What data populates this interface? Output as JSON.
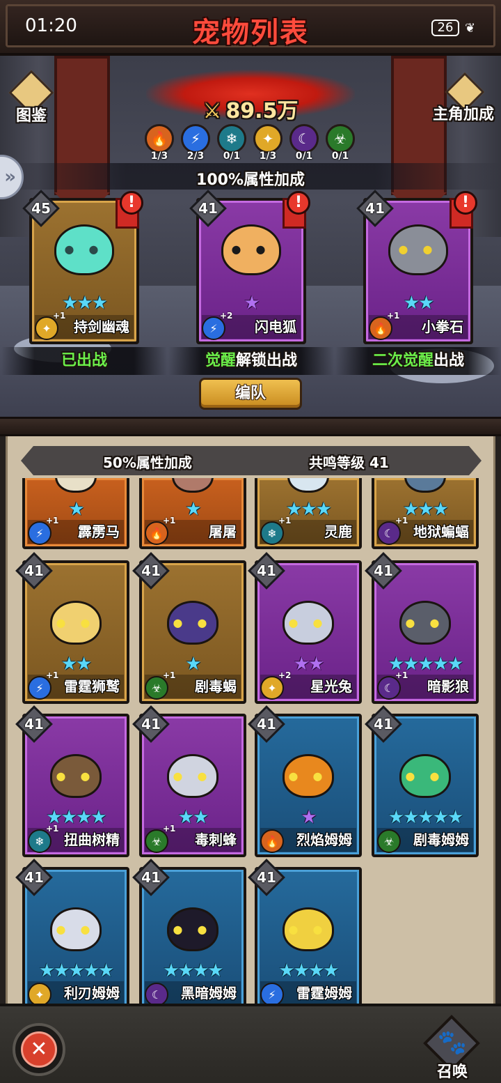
{
  "status_bar": {
    "time": "01:20",
    "alert_glyph": "!",
    "battery": "26"
  },
  "header": {
    "title": "宠物列表"
  },
  "scene": {
    "atlas_label": "图鉴",
    "hero_bonus_label": "主角加成",
    "power": "89.5万",
    "elements": [
      {
        "icon": "fire-element-icon",
        "count": "1/3",
        "color": "#d8641e",
        "glyph": "🔥"
      },
      {
        "icon": "lightning-element-icon",
        "count": "2/3",
        "color": "#2a6ee0",
        "glyph": "⚡"
      },
      {
        "icon": "ice-element-icon",
        "count": "0/1",
        "color": "#1e7a8a",
        "glyph": "❄"
      },
      {
        "icon": "light-element-icon",
        "count": "1/3",
        "color": "#e0a828",
        "glyph": "✦"
      },
      {
        "icon": "dark-element-icon",
        "count": "0/1",
        "color": "#5a2a8a",
        "glyph": "☾"
      },
      {
        "icon": "poison-element-icon",
        "count": "0/1",
        "color": "#2a7a2a",
        "glyph": "☣"
      }
    ],
    "attribute_bonus": "100%属性加成",
    "team_button": "编队"
  },
  "deployed": [
    {
      "name": "持剑幽魂",
      "level": "45",
      "stars": "★★★",
      "star_type": "b",
      "rarity": "gold",
      "element": "light",
      "plus": "+1",
      "status_parts": [
        {
          "text": "已出战",
          "color": "g"
        }
      ],
      "pet_color": "#5ee0c8",
      "eye": "#2a4a4a"
    },
    {
      "name": "闪电狐",
      "level": "41",
      "stars": "★",
      "star_type": "p",
      "rarity": "purple",
      "element": "lightning",
      "plus": "+2",
      "status_parts": [
        {
          "text": "觉醒",
          "color": "g"
        },
        {
          "text": "解锁出战",
          "color": "w"
        }
      ],
      "pet_color": "#f0b060",
      "eye": "#1a1a1a"
    },
    {
      "name": "小拳石",
      "level": "41",
      "stars": "★★",
      "star_type": "b",
      "rarity": "purple",
      "element": "fire",
      "plus": "+1",
      "status_parts": [
        {
          "text": "二次觉醒",
          "color": "g"
        },
        {
          "text": "出战",
          "color": "w"
        }
      ],
      "pet_color": "#8a8e98",
      "eye": "#f0d030"
    }
  ],
  "list": {
    "attribute_bonus": "50%属性加成",
    "resonance": "共鸣等级 41",
    "pets": [
      {
        "name": "霹雳马",
        "level": "",
        "stars": "★",
        "star_type": "b",
        "rarity": "orange",
        "element": "lightning",
        "plus": "+1",
        "pet_color": "#e8e0c8",
        "partial": true
      },
      {
        "name": "屠屠",
        "level": "",
        "stars": "★",
        "star_type": "b",
        "rarity": "orange",
        "element": "fire",
        "plus": "+1",
        "pet_color": "#b07a6a",
        "partial": true
      },
      {
        "name": "灵鹿",
        "level": "",
        "stars": "★★★",
        "star_type": "b",
        "rarity": "gold",
        "element": "ice",
        "plus": "+1",
        "pet_color": "#d8e6f0",
        "partial": true
      },
      {
        "name": "地狱蝙蝠",
        "level": "",
        "stars": "★★★",
        "star_type": "b",
        "rarity": "gold",
        "element": "dark",
        "plus": "+1",
        "pet_color": "#5a7a9a",
        "partial": true
      },
      {
        "name": "雷霆狮鹫",
        "level": "41",
        "stars": "★★",
        "star_type": "b",
        "rarity": "gold",
        "element": "lightning",
        "plus": "+1",
        "pet_color": "#f0d070"
      },
      {
        "name": "剧毒蝎",
        "level": "41",
        "stars": "★",
        "star_type": "b",
        "rarity": "gold",
        "element": "poison",
        "plus": "+1",
        "pet_color": "#4a3a8a"
      },
      {
        "name": "星光兔",
        "level": "41",
        "stars": "★★",
        "star_type": "p",
        "rarity": "purple",
        "element": "light",
        "plus": "+2",
        "pet_color": "#c8cede"
      },
      {
        "name": "暗影狼",
        "level": "41",
        "stars": "★★★★★",
        "star_type": "b",
        "rarity": "purple",
        "element": "dark",
        "plus": "+1",
        "pet_color": "#5a5e6a"
      },
      {
        "name": "扭曲树精",
        "level": "41",
        "stars": "★★★★",
        "star_type": "b",
        "rarity": "purple",
        "element": "ice",
        "plus": "+1",
        "pet_color": "#7a5a3a"
      },
      {
        "name": "毒刺蜂",
        "level": "41",
        "stars": "★★",
        "star_type": "b",
        "rarity": "purple",
        "element": "poison",
        "plus": "+1",
        "pet_color": "#d0d4e0"
      },
      {
        "name": "烈焰姆姆",
        "level": "41",
        "stars": "★",
        "star_type": "p",
        "rarity": "blue",
        "element": "fire",
        "plus": "",
        "pet_color": "#e8881e"
      },
      {
        "name": "剧毒姆姆",
        "level": "41",
        "stars": "★★★★★",
        "star_type": "b",
        "rarity": "blue",
        "element": "poison",
        "plus": "",
        "pet_color": "#3ab87a"
      },
      {
        "name": "利刃姆姆",
        "level": "41",
        "stars": "★★★★★",
        "star_type": "b",
        "rarity": "blue",
        "element": "light",
        "plus": "",
        "pet_color": "#d8dce8"
      },
      {
        "name": "黑暗姆姆",
        "level": "41",
        "stars": "★★★★",
        "star_type": "b",
        "rarity": "blue",
        "element": "dark",
        "plus": "",
        "pet_color": "#1e1a2a"
      },
      {
        "name": "雷霆姆姆",
        "level": "41",
        "stars": "★★★★",
        "star_type": "b",
        "rarity": "blue",
        "element": "lightning",
        "plus": "",
        "pet_color": "#f0d040"
      }
    ]
  },
  "bottom": {
    "summon_label": "召唤"
  },
  "element_styles": {
    "fire": {
      "color": "#d8641e",
      "glyph": "🔥"
    },
    "lightning": {
      "color": "#2a6ee0",
      "glyph": "⚡"
    },
    "ice": {
      "color": "#1e7a8a",
      "glyph": "❄"
    },
    "light": {
      "color": "#e0a828",
      "glyph": "✦"
    },
    "dark": {
      "color": "#5a2a8a",
      "glyph": "☾"
    },
    "poison": {
      "color": "#2a7a2a",
      "glyph": "☣"
    }
  }
}
